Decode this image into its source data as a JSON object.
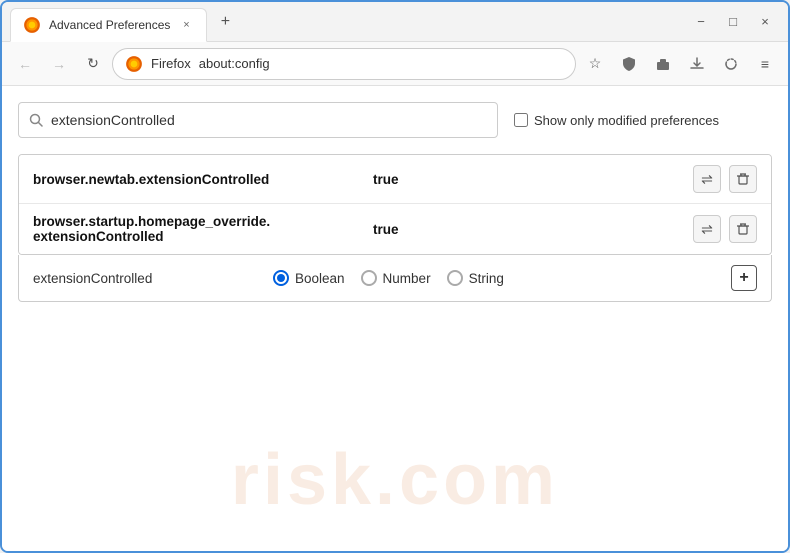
{
  "window": {
    "title": "Advanced Preferences",
    "tab_label": "Advanced Preferences",
    "close_label": "×",
    "minimize_label": "−",
    "maximize_label": "□",
    "new_tab_label": "+"
  },
  "navbar": {
    "back_label": "←",
    "forward_label": "→",
    "reload_label": "↻",
    "browser_name": "Firefox",
    "address": "about:config",
    "menu_label": "≡",
    "bookmark_label": "☆",
    "shield_label": "🛡",
    "extension_label": "🧩",
    "download_label": "⬇",
    "sync_label": "⟳"
  },
  "search": {
    "placeholder": "extensionControlled",
    "value": "extensionControlled",
    "show_modified_label": "Show only modified preferences"
  },
  "preferences": [
    {
      "name": "browser.newtab.extensionControlled",
      "value": "true",
      "reset_label": "⇌",
      "delete_label": "🗑"
    },
    {
      "name_line1": "browser.startup.homepage_override.",
      "name_line2": "extensionControlled",
      "value": "true",
      "reset_label": "⇌",
      "delete_label": "🗑"
    }
  ],
  "new_pref": {
    "name": "extensionControlled",
    "types": [
      {
        "label": "Boolean",
        "checked": true
      },
      {
        "label": "Number",
        "checked": false
      },
      {
        "label": "String",
        "checked": false
      }
    ],
    "add_label": "+"
  },
  "watermark": {
    "line1": "risk.com"
  }
}
